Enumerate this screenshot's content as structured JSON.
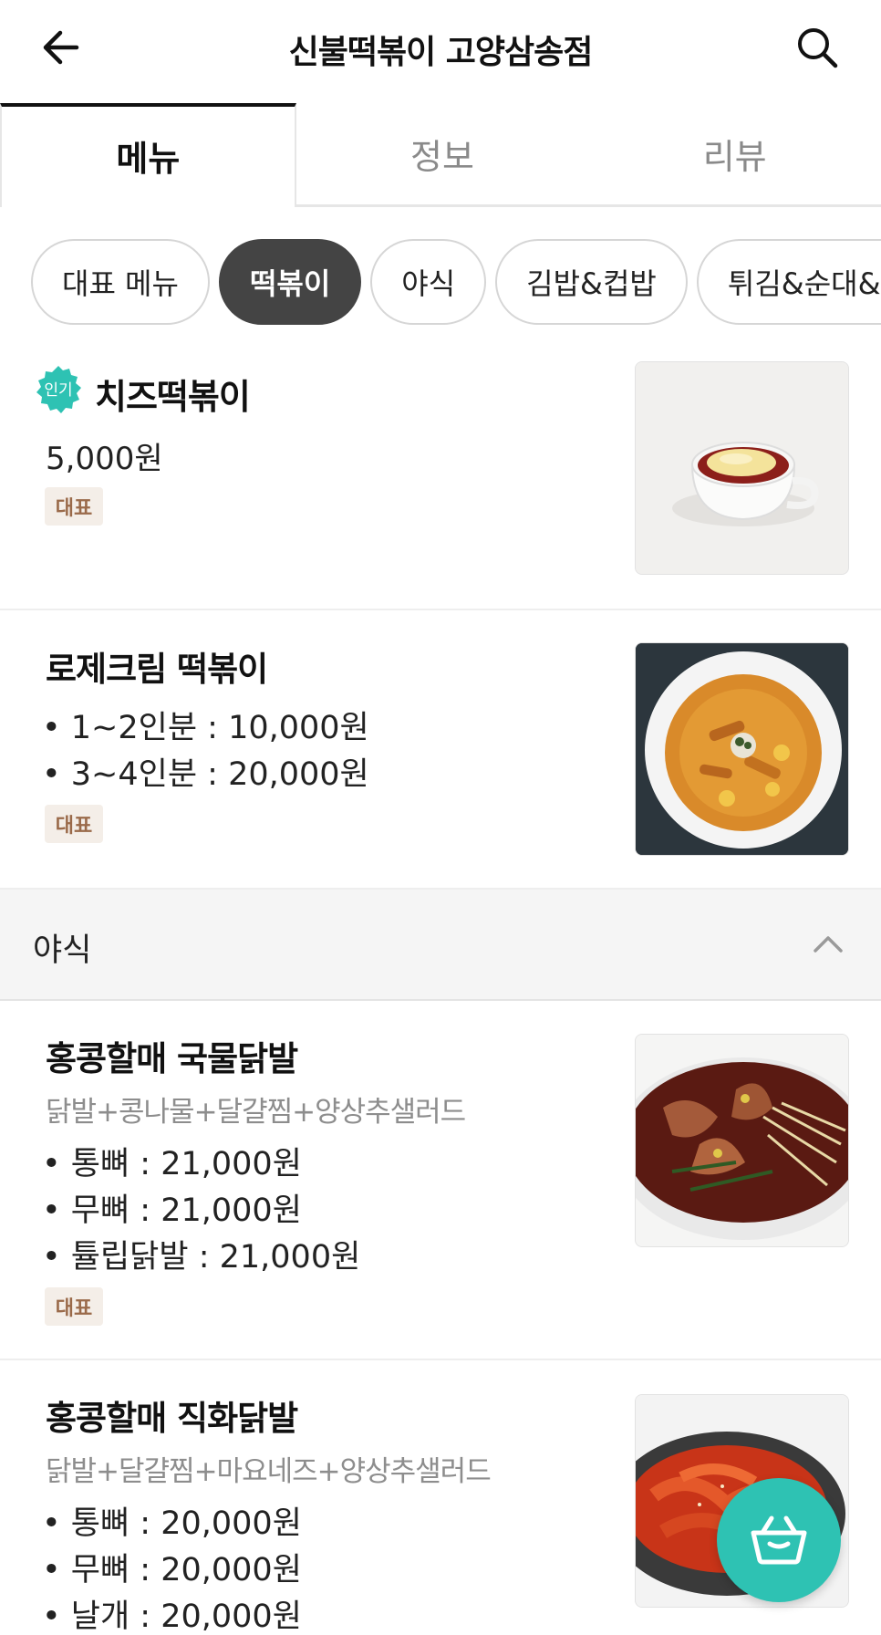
{
  "header": {
    "title": "신불떡볶이 고양삼송점",
    "back_icon": "arrow-left-icon",
    "search_icon": "search-icon"
  },
  "tabs": [
    {
      "label": "메뉴",
      "active": true
    },
    {
      "label": "정보",
      "active": false
    },
    {
      "label": "리뷰",
      "active": false
    }
  ],
  "chips": [
    {
      "label": "대표 메뉴",
      "active": false
    },
    {
      "label": "떡볶이",
      "active": true
    },
    {
      "label": "야식",
      "active": false
    },
    {
      "label": "김밥&컵밥",
      "active": false
    },
    {
      "label": "튀김&순대&어묵",
      "active": false
    }
  ],
  "items": [
    {
      "name": "치즈떡볶이",
      "popular_badge": "인기",
      "price": "5,000원",
      "badge": "대표"
    },
    {
      "name": "로제크림 떡볶이",
      "options": [
        "1~2인분 : 10,000원",
        "3~4인분 : 20,000원"
      ],
      "badge": "대표"
    },
    {
      "name": "홍콩할매 국물닭발",
      "desc": "닭발+콩나물+달걀찜+양상추샐러드",
      "options": [
        "통뼈 : 21,000원",
        "무뼈 : 21,000원",
        "튤립닭발 : 21,000원"
      ],
      "badge": "대표"
    },
    {
      "name": "홍콩할매  직화닭발",
      "desc": "닭발+달걀찜+마요네즈+양상추샐러드",
      "options": [
        "통뼈 : 20,000원",
        "무뼈 : 20,000원",
        "날개 : 20,000원"
      ]
    }
  ],
  "section": {
    "title": "야식",
    "icon": "chevron-up-icon"
  },
  "cart": {
    "icon": "shopping-basket-icon",
    "color": "#2ec2b3"
  }
}
